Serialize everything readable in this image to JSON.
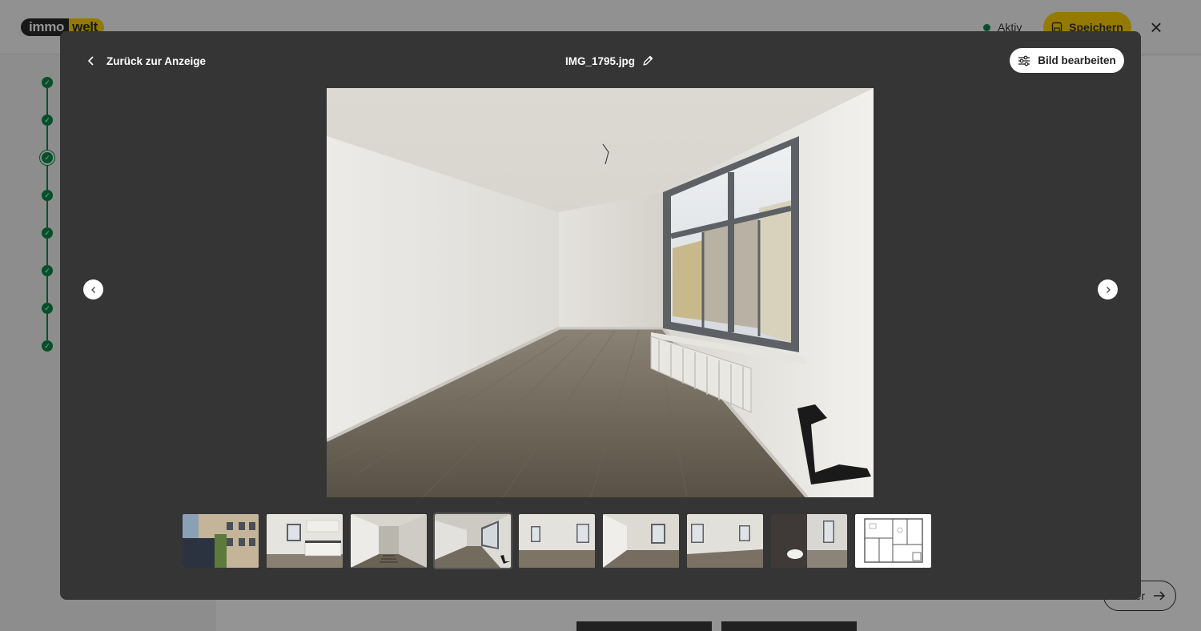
{
  "background": {
    "logo": {
      "part1": "immo",
      "part2": "welt"
    },
    "status_label": "Aktiv",
    "save_label": "Speichern",
    "close_glyph": "×",
    "next_label": "Weiter",
    "step_check": "✓"
  },
  "modal": {
    "back_label": "Zurück zur Anzeige",
    "file_name": "IMG_1795.jpg",
    "edit_label": "Bild bearbeiten",
    "active_thumb_index": 3,
    "thumbnail_count": 9
  },
  "colors": {
    "accent": "#ffd200",
    "success": "#0a8a4a",
    "modal_bg": "#353535"
  },
  "icons": {
    "back": "chevron-left-icon",
    "rename": "pencil-icon",
    "edit": "sliders-icon",
    "prev": "chevron-left-icon",
    "next": "chevron-right-icon"
  }
}
